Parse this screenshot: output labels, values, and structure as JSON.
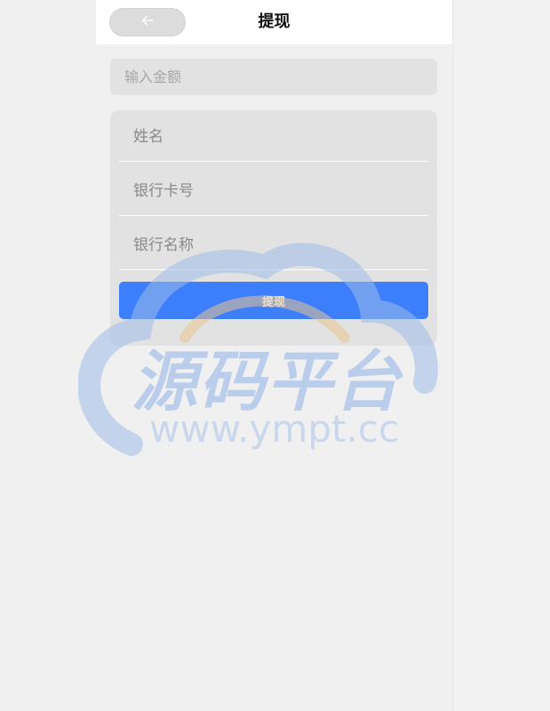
{
  "header": {
    "title": "提现",
    "back_icon": "arrow-left-icon"
  },
  "form": {
    "amount_placeholder": "输入金额",
    "name_placeholder": "姓名",
    "card_number_placeholder": "银行卡号",
    "bank_name_placeholder": "银行名称",
    "submit_label": "提现"
  },
  "watermark": {
    "text_cn": "源码平台",
    "text_url": "www.ympt.cc"
  },
  "colors": {
    "primary": "#3d7efd",
    "page_bg": "#f0f0f0",
    "card_bg": "#e2e2e2",
    "header_bg": "#ffffff"
  }
}
